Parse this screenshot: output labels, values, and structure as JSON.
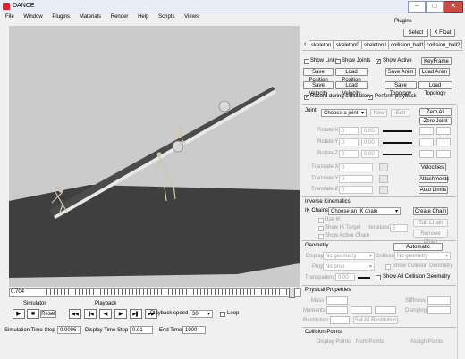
{
  "window": {
    "title": "DANCE",
    "min_icon": "minimize-icon",
    "max_icon": "maximize-icon",
    "close_icon": "close-icon",
    "minimize": "–",
    "maximize": "□",
    "close": "✕"
  },
  "menu": [
    "File",
    "Window",
    "Plugins",
    "Materials",
    "Render",
    "Help",
    "Scripts",
    "Views"
  ],
  "plugins": {
    "title": "Plugins",
    "select": "Select",
    "float": "X Float"
  },
  "tabs": {
    "arrow": "‹",
    "items": [
      "skeleton",
      "skeleton0",
      "skeleton1",
      "collision_ball1",
      "collision_ball2"
    ]
  },
  "toggles": {
    "show_links": "Show Links",
    "show_joints": "Show Joints",
    "show_active": "Show Active",
    "keyframe": "KeyFrame",
    "record": "Record during simulation",
    "perform": "Perform playback"
  },
  "save_buttons": {
    "save_position": "Save Position",
    "load_position": "Load Position",
    "save_anim": "Save Anim",
    "load_anim": "Load Anim",
    "save_velocity": "Save Velocity",
    "load_velocity": "Load Velocity",
    "save_topology": "Save Topology",
    "load_topology": "Load Topology"
  },
  "joint": {
    "label": "Joint",
    "choose": "Choose a joint",
    "new": "New",
    "edit": "Edit",
    "zero_all": "Zero All",
    "zero_joint": "Zero Joint",
    "rotate_x": "Rotate X",
    "rotate_y": "Rotate Y",
    "rotate_z": "Rotate Z",
    "translate_x": "Translate X",
    "translate_y": "Translate Y",
    "translate_z": "Translate Z",
    "zero": "0",
    "zero_val": "0.00",
    "velocities": "Velocities",
    "attachments": "Attachments",
    "auto_limits": "Auto Limits"
  },
  "ik": {
    "title": "Inverse Kinematics",
    "chains": "IK Chains",
    "choose_chain": "Choose an IK chain",
    "create": "Create Chain",
    "edit": "Edit Chain",
    "remove": "Remove Chain",
    "use_ik": "Use IK",
    "show_target": "Show IK Target",
    "iterations": "Iterations",
    "iter_val": "5",
    "show_active_chain": "Show Active Chain"
  },
  "geometry": {
    "title": "Geometry",
    "auto": "Automatic Geometry",
    "display": "Display",
    "display_val": "No geometry",
    "collision": "Collision",
    "collision_val": "No geometry",
    "prop": "Prop",
    "prop_val": "No prop",
    "show_collision": "Show Collision Geometry",
    "transparency": "Transparency",
    "transparency_val": "0.00",
    "show_all": "Show All Collision Geometry"
  },
  "physical": {
    "title": "Physical Properties",
    "mass": "Mass",
    "stiffness": "Stiffness",
    "moments": "Moments",
    "damping": "Damping",
    "restitution": "Restitution",
    "set_all": "Set All Restitution"
  },
  "collision_points": {
    "title": "Collision Points",
    "display": "Display Points",
    "num": "Num Points",
    "assign": "Assign Points"
  },
  "timeline": {
    "current": "0.704"
  },
  "simulator": {
    "label": "Simulator",
    "play": "▶",
    "stop": "■",
    "reset": "Reset"
  },
  "playback": {
    "label": "Playback",
    "buttons": [
      "◀◀",
      "▐◀",
      "◀",
      "▶",
      "▶▌",
      "▶▶"
    ],
    "speed_label": "Playback speed",
    "speed": "30",
    "loop": "Loop"
  },
  "time_steps": {
    "sim_label": "Simulation Time Step",
    "sim_val": "0.0006",
    "disp_label": "Display Time Step",
    "disp_val": "0.01",
    "end_label": "End Time",
    "end_val": "1000"
  }
}
